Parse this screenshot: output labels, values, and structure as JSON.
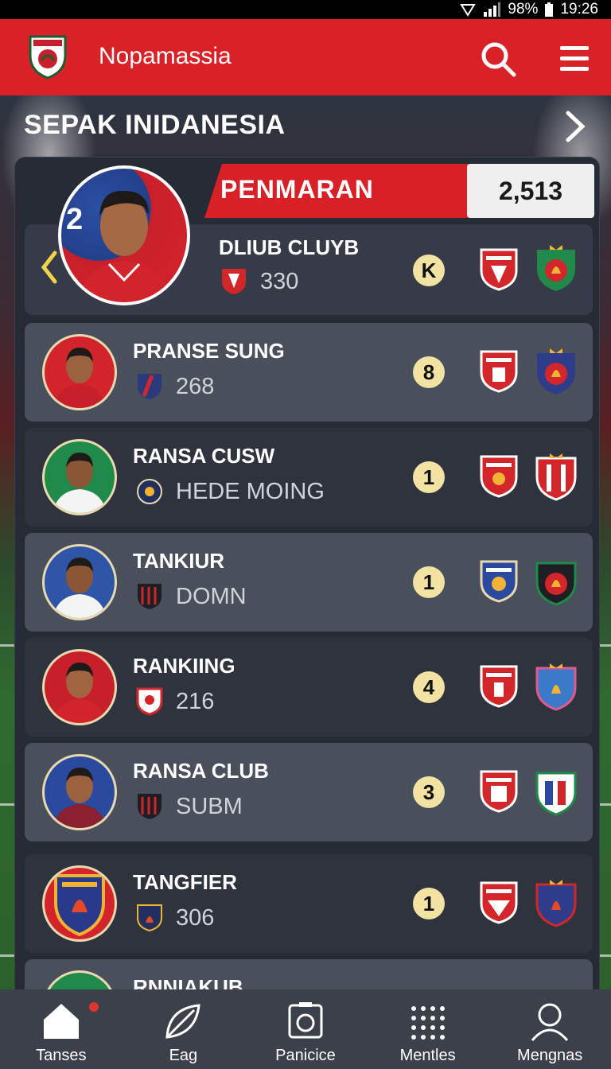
{
  "status_bar": {
    "battery": "98%",
    "time": "19:26"
  },
  "app_bar": {
    "title": "Nopamassia"
  },
  "section": {
    "title": "SEPAK INIDANESIA"
  },
  "featured": {
    "banner_label": "PENMARAN",
    "score": "2,513",
    "name": "DLIUB CLUYB",
    "sub": "330",
    "rank": "K"
  },
  "rows": [
    {
      "name": "PRANSE SUNG",
      "sub": "268",
      "rank": "8"
    },
    {
      "name": "RANSA CUSW",
      "sub": "HEDE MOING",
      "rank": "1"
    },
    {
      "name": "TANKIUR",
      "sub": "DOMN",
      "rank": "1"
    },
    {
      "name": "RANKIING",
      "sub": "216",
      "rank": "4"
    },
    {
      "name": "RANSA CLUB",
      "sub": "SUBM",
      "rank": "3"
    },
    {
      "name": "TANGFIER",
      "sub": "306",
      "rank": "1"
    },
    {
      "name": "RNNIAKUB",
      "sub": "",
      "rank": ""
    }
  ],
  "nav": [
    {
      "label": "Tanses",
      "icon": "home-icon"
    },
    {
      "label": "Eag",
      "icon": "leaf-icon"
    },
    {
      "label": "Panicice",
      "icon": "camera-icon"
    },
    {
      "label": "Mentles",
      "icon": "grid-icon"
    },
    {
      "label": "Mengnas",
      "icon": "profile-icon"
    }
  ],
  "colors": {
    "brand_red": "#d92128",
    "panel": "#262b35",
    "row_light": "#4a4f5c",
    "row_dark": "#2e333e",
    "rank_badge": "#f2e3a2",
    "nav_bg": "#3b404b"
  }
}
